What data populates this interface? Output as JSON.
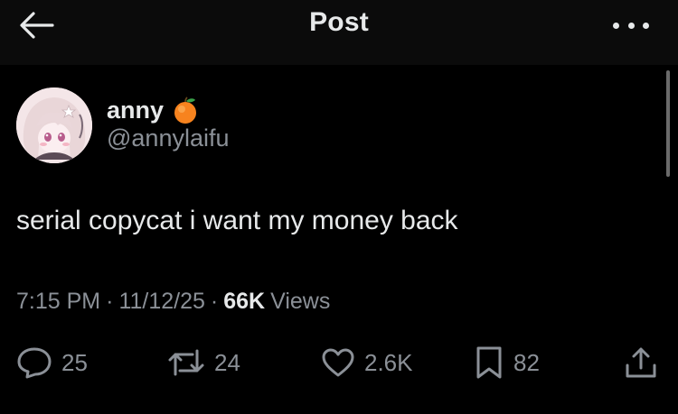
{
  "header": {
    "title": "Post",
    "back_icon": "arrow-left-icon",
    "more_icon": "more-horizontal-icon"
  },
  "author": {
    "display_name": "anny",
    "badge_emoji_icon": "orange-emoji-icon",
    "handle": "@annylaifu"
  },
  "post": {
    "text": "serial copycat i want my money back",
    "time": "7:15 PM",
    "date": "11/12/25",
    "separator": "·",
    "views_count": "66K",
    "views_label": "Views"
  },
  "actions": {
    "replies": "25",
    "reposts": "24",
    "likes": "2.6K",
    "bookmarks": "82"
  },
  "colors": {
    "background": "#000000",
    "header_background": "#0b0b0b",
    "primary_text": "#e7e9ea",
    "secondary_text": "#8b9097"
  }
}
